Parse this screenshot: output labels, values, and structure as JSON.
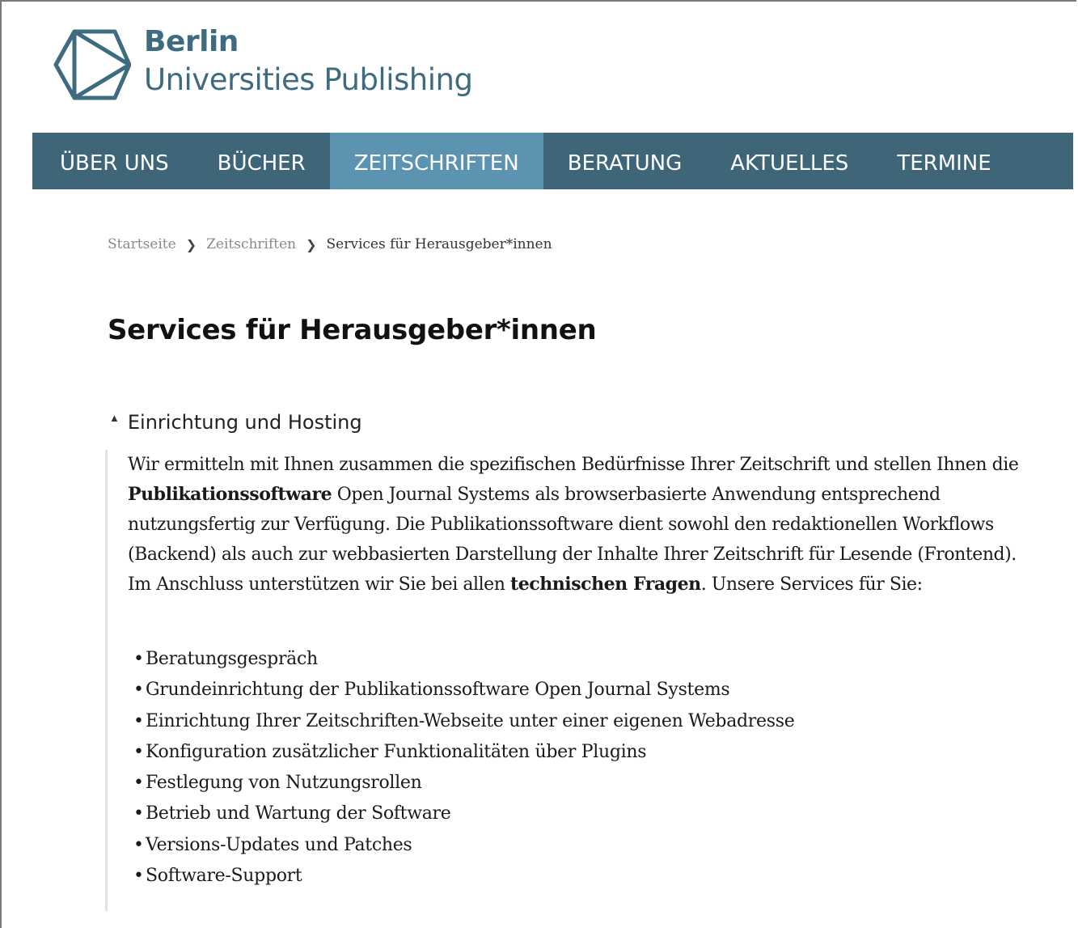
{
  "brand": {
    "line1": "Berlin",
    "line2": "Universities Publishing",
    "logo_icon": "hexagon-triangle-logo-icon",
    "color": "#3f6b80"
  },
  "nav": {
    "items": [
      {
        "label": "ÜBER UNS"
      },
      {
        "label": "BÜCHER"
      },
      {
        "label": "ZEITSCHRIFTEN",
        "active": true
      },
      {
        "label": "BERATUNG"
      },
      {
        "label": "AKTUELLES"
      },
      {
        "label": "TERMINE"
      }
    ],
    "bg_color": "#3f6678",
    "active_color": "#5b93b0"
  },
  "breadcrumb": {
    "items": [
      "Startseite",
      "Zeitschriften"
    ],
    "current": "Services für Herausgeber*innen",
    "separator_icon": "chevron-right-icon"
  },
  "page": {
    "title": "Services für Herausgeber*innen"
  },
  "accordion": {
    "title": "Einrichtung und Hosting",
    "state": "expanded",
    "toggle_icon": "caret-up-icon",
    "intro_parts": [
      "Wir ermitteln mit Ihnen zusammen die spezifischen Bedürfnisse Ihrer Zeitschrift und stellen Ihnen die ",
      "Publikationssoftware",
      " Open Journal Systems als browserbasierte Anwendung entsprechend nutzungsfertig zur Verfügung. Die Publikationssoftware dient sowohl den redaktionellen Workflows (Backend) als auch zur webbasierten Darstellung der Inhalte Ihrer Zeitschrift für Lesende (Frontend). Im Anschluss unterstützen wir Sie bei allen ",
      "technischen Fragen",
      ". Unsere Services für Sie:"
    ],
    "services": [
      "Beratungsgespräch",
      "Grundeinrichtung der Publikationssoftware Open Journal Systems",
      "Einrichtung Ihrer Zeitschriften-Webseite unter einer eigenen Webadresse",
      "Konfiguration zusätzlicher Funktionalitäten über Plugins",
      "Festlegung von Nutzungsrollen",
      "Betrieb und Wartung der Software",
      "Versions-Updates und Patches",
      "Software-Support"
    ]
  }
}
